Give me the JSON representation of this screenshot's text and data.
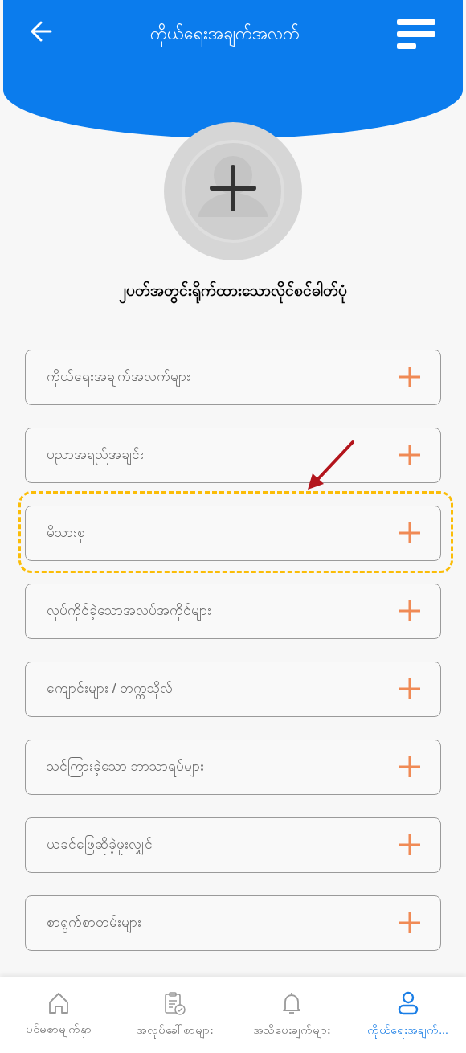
{
  "header": {
    "title": "ကိုယ်ရေးအချက်အလက်"
  },
  "photo_caption": "၂ပတ်အတွင်းရိုက်ထားသောလိုင်စင်ဓါတ်ပုံ",
  "sections": [
    {
      "label": "ကိုယ်ရေးအချက်အလက်များ",
      "highlighted": false
    },
    {
      "label": "ပညာအရည်အချင်း",
      "highlighted": false
    },
    {
      "label": "မိသားစု",
      "highlighted": true
    },
    {
      "label": "လုပ်ကိုင်ခဲ့သောအလုပ်အကိုင်များ",
      "highlighted": false
    },
    {
      "label": "ကျောင်းများ / တက္ကသိုလ်",
      "highlighted": false
    },
    {
      "label": "သင်ကြားခဲ့သော ဘာသာရပ်များ",
      "highlighted": false
    },
    {
      "label": "ယခင်ဖြေဆိုခဲ့ဖူးလျှင်",
      "highlighted": false
    },
    {
      "label": "စာရွက်စာတမ်းများ",
      "highlighted": false
    }
  ],
  "bottom_nav": [
    {
      "kind": "home",
      "label": "ပင်မစာမျက်နှာ",
      "selected": false
    },
    {
      "kind": "jobs",
      "label": "အလုပ်ခေါ်စာများ",
      "selected": false
    },
    {
      "kind": "notifications",
      "label": "အသိပေးချက်များ",
      "selected": false
    },
    {
      "kind": "profile",
      "label": "ကိုယ်ရေးအချက်...",
      "selected": true
    }
  ]
}
